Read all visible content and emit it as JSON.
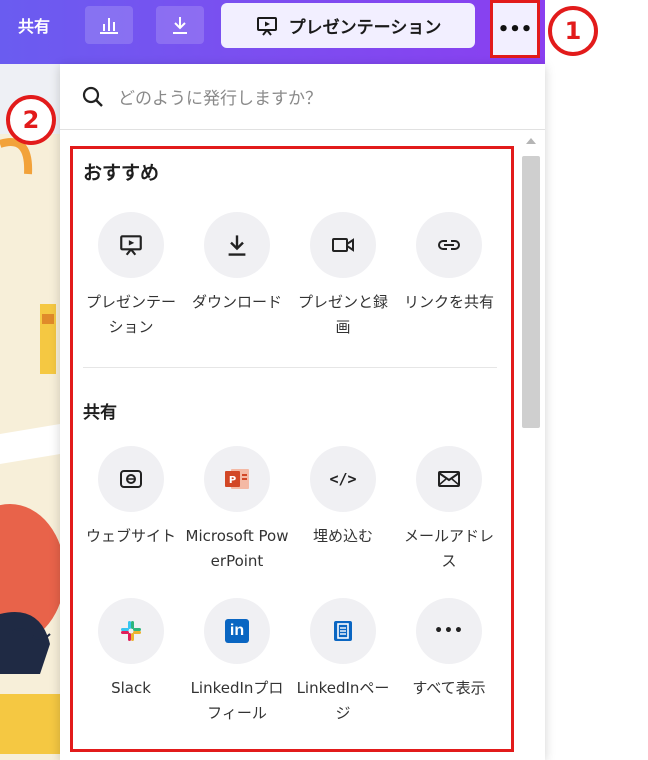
{
  "toolbar": {
    "share_label": "共有",
    "present_label": "プレゼンテーション",
    "more_label": "•••"
  },
  "annotations": {
    "one": "1",
    "two": "2"
  },
  "search": {
    "placeholder": "どのように発行しますか？"
  },
  "recommended": {
    "title": "おすすめ",
    "items": [
      {
        "label": "プレゼンテーション",
        "icon": "present-icon"
      },
      {
        "label": "ダウンロード",
        "icon": "download-icon"
      },
      {
        "label": "プレゼンと録画",
        "icon": "video-icon"
      },
      {
        "label": "リンクを共有",
        "icon": "link-icon"
      }
    ]
  },
  "share": {
    "title": "共有",
    "items": [
      {
        "label": "ウェブサイト",
        "icon": "website-icon"
      },
      {
        "label": "Microsoft PowerPoint",
        "icon": "powerpoint-icon"
      },
      {
        "label": "埋め込む",
        "icon": "embed-icon",
        "glyph": "</>"
      },
      {
        "label": "メールアドレス",
        "icon": "email-icon"
      },
      {
        "label": "Slack",
        "icon": "slack-icon"
      },
      {
        "label": "LinkedInプロフィール",
        "icon": "linkedin-icon",
        "glyph": "in"
      },
      {
        "label": "LinkedInページ",
        "icon": "linkedin-page-icon"
      },
      {
        "label": "すべて表示",
        "icon": "more-icon",
        "glyph": "•••"
      }
    ]
  },
  "colors": {
    "toolbar_gradient_start": "#6a5cf0",
    "toolbar_gradient_end": "#8a3ff0",
    "highlight_red": "#e21b1b",
    "icon_circle": "#f0f0f3",
    "powerpoint": "#d24726",
    "linkedin": "#0a66c2"
  }
}
